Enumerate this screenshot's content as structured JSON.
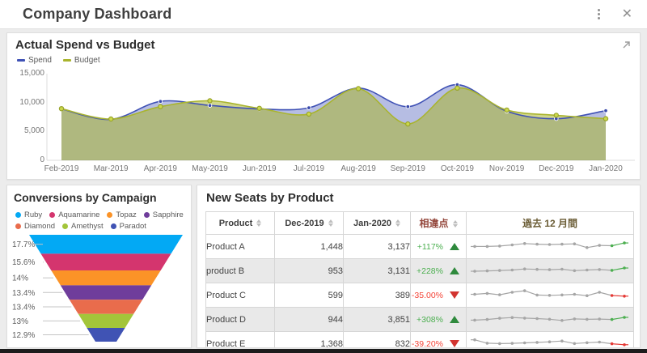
{
  "titlebar": {
    "title": "Company Dashboard"
  },
  "spend_chart": {
    "title": "Actual Spend vs Budget",
    "y_max": 15000,
    "y_ticks": [
      {
        "label": "15,000",
        "value": 15000
      },
      {
        "label": "10,000",
        "value": 10000
      },
      {
        "label": "5,000",
        "value": 5000
      },
      {
        "label": "0",
        "value": 0
      }
    ],
    "months": [
      "Feb-2019",
      "Mar-2019",
      "Apr-2019",
      "May-2019",
      "Jun-2019",
      "Jul-2019",
      "Aug-2019",
      "Sep-2019",
      "Oct-2019",
      "Nov-2019",
      "Dec-2019",
      "Jan-2020"
    ],
    "series": [
      {
        "name": "Spend",
        "color": "#3f51b5",
        "fill": "rgba(63,81,181,0.38)",
        "values": [
          8900,
          7100,
          10200,
          9500,
          8900,
          9100,
          12500,
          9300,
          13100,
          8500,
          7200,
          8600
        ]
      },
      {
        "name": "Budget",
        "color": "#a9b42e",
        "fill": "rgba(169,180,46,0.55)",
        "values": [
          8950,
          7150,
          9300,
          10300,
          9000,
          8000,
          12400,
          6300,
          12500,
          8700,
          7800,
          7200
        ]
      }
    ]
  },
  "funnel": {
    "title": "Conversions by Campaign",
    "segments": [
      {
        "label": "Ruby",
        "pct": 17.7,
        "pct_label": "17.7%",
        "color": "#03a9f4"
      },
      {
        "label": "Aquamarine",
        "pct": 15.6,
        "pct_label": "15.6%",
        "color": "#d4356e"
      },
      {
        "label": "Topaz",
        "pct": 14.0,
        "pct_label": "14%",
        "color": "#fb9327"
      },
      {
        "label": "Sapphire",
        "pct": 13.4,
        "pct_label": "13.4%",
        "color": "#6f3d9b"
      },
      {
        "label": "Diamond",
        "pct": 13.4,
        "pct_label": "13.4%",
        "color": "#e96c4c"
      },
      {
        "label": "Amethyst",
        "pct": 13.0,
        "pct_label": "13%",
        "color": "#a3c53a"
      },
      {
        "label": "Paradot",
        "pct": 12.9,
        "pct_label": "12.9%",
        "color": "#4053b4"
      }
    ]
  },
  "table": {
    "title": "New Seats by Product",
    "columns": [
      {
        "label": "Product",
        "sortable": true
      },
      {
        "label": "Dec-2019",
        "sortable": true
      },
      {
        "label": "Jan-2020",
        "sortable": true
      },
      {
        "label": "相違点",
        "sortable": true
      },
      {
        "label": "過去 12 月間",
        "sortable": false
      }
    ],
    "spark_colors": {
      "base": "#a6a6a6",
      "up": "#4caf50",
      "down": "#e53935"
    },
    "rows": [
      {
        "product": "Product A",
        "dec": "1,448",
        "jan": "3,137",
        "diff": "+117%",
        "dir": "up",
        "spark": [
          45,
          45,
          48,
          55,
          64,
          60,
          58,
          60,
          62,
          38,
          52,
          50,
          68
        ]
      },
      {
        "product": "product B",
        "dec": "953",
        "jan": "3,131",
        "diff": "+228%",
        "dir": "up",
        "spark": [
          42,
          44,
          47,
          50,
          57,
          54,
          52,
          55,
          46,
          50,
          53,
          48,
          63
        ]
      },
      {
        "product": "Product C",
        "dec": "599",
        "jan": "389",
        "diff": "-35.00%",
        "dir": "down",
        "spark": [
          50,
          56,
          47,
          63,
          73,
          45,
          43,
          46,
          50,
          41,
          63,
          42,
          38
        ]
      },
      {
        "product": "Product D",
        "dec": "944",
        "jan": "3,851",
        "diff": "+308%",
        "dir": "up",
        "spark": [
          40,
          44,
          52,
          57,
          53,
          50,
          46,
          38,
          48,
          45,
          47,
          44,
          58
        ]
      },
      {
        "product": "Product E",
        "dec": "1,368",
        "jan": "832",
        "diff": "-39.20%",
        "dir": "down",
        "spark": [
          70,
          48,
          45,
          47,
          50,
          53,
          57,
          62,
          46,
          51,
          55,
          44,
          38
        ]
      }
    ]
  }
}
